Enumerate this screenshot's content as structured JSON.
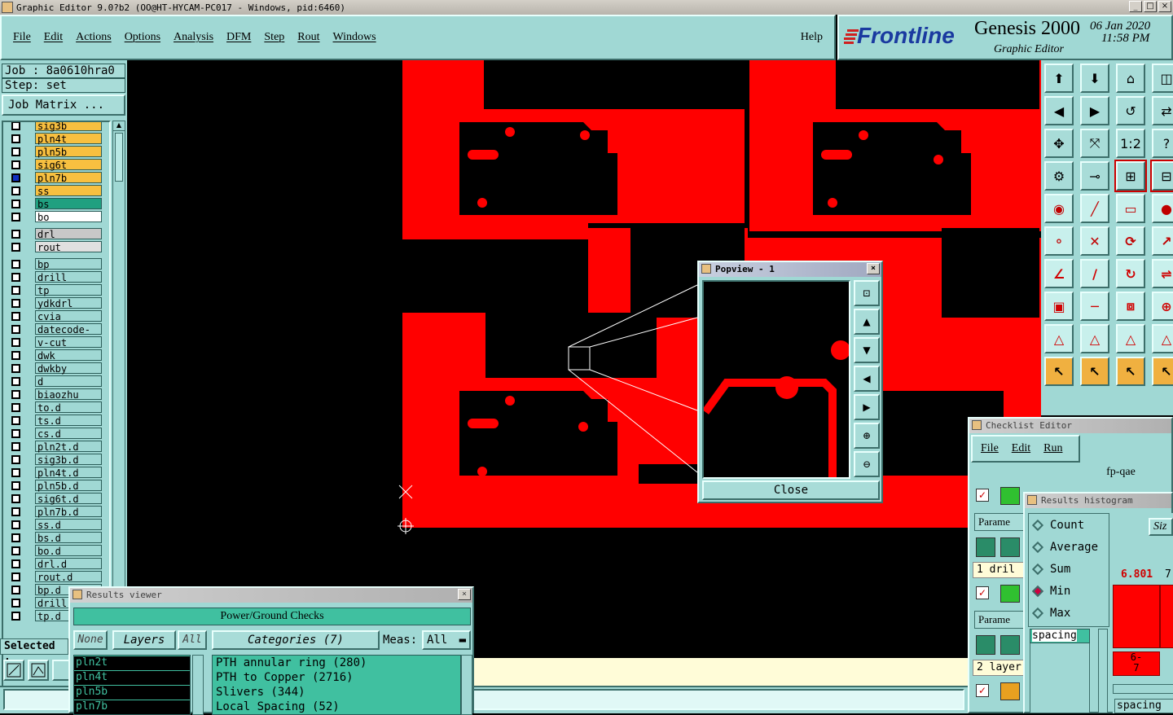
{
  "window": {
    "title": "Graphic Editor 9.0?b2 (OO@HT-HYCAM-PC017 - Windows, pid:6460)",
    "controls": [
      "_",
      "□",
      "×"
    ]
  },
  "menu": {
    "items": [
      "File",
      "Edit",
      "Actions",
      "Options",
      "Analysis",
      "DFM",
      "Step",
      "Rout",
      "Windows"
    ],
    "help": "Help"
  },
  "brand": {
    "logo": "Frontline",
    "product": "Genesis 2000",
    "subtitle": "Graphic Editor",
    "date": "06 Jan 2020",
    "time": "11:58 PM"
  },
  "job": {
    "job_label": "Job : 8a0610hra0",
    "step_label": "Step: set",
    "matrix_button": "Job Matrix ..."
  },
  "layers": [
    {
      "name": "sig3b",
      "color": "#f8c040"
    },
    {
      "name": "pln4t",
      "color": "#f8c040"
    },
    {
      "name": "pln5b",
      "color": "#f8c040"
    },
    {
      "name": "sig6t",
      "color": "#f8c040"
    },
    {
      "name": "pln7b",
      "color": "#f8c040",
      "active": true
    },
    {
      "name": "ss",
      "color": "#f8c040"
    },
    {
      "name": "bs",
      "color": "#20a080"
    },
    {
      "name": "bo",
      "color": "#ffffff"
    },
    {
      "name": "drl",
      "color": "#c8c8c8"
    },
    {
      "name": "rout",
      "color": "#e0e0e0"
    },
    {
      "name": "bp",
      "color": "#a0d8d4"
    },
    {
      "name": "drill",
      "color": "#a0d8d4"
    },
    {
      "name": "tp",
      "color": "#a0d8d4"
    },
    {
      "name": "ydkdrl",
      "color": "#a0d8d4"
    },
    {
      "name": "cvia",
      "color": "#a0d8d4"
    },
    {
      "name": "datecode-pbc",
      "color": "#a0d8d4"
    },
    {
      "name": "v-cut",
      "color": "#a0d8d4"
    },
    {
      "name": "dwk",
      "color": "#a0d8d4"
    },
    {
      "name": "dwkby",
      "color": "#a0d8d4"
    },
    {
      "name": "d",
      "color": "#a0d8d4"
    },
    {
      "name": "biaozhu",
      "color": "#a0d8d4"
    },
    {
      "name": "to.d",
      "color": "#a0d8d4"
    },
    {
      "name": "ts.d",
      "color": "#a0d8d4"
    },
    {
      "name": "cs.d",
      "color": "#a0d8d4"
    },
    {
      "name": "pln2t.d",
      "color": "#a0d8d4"
    },
    {
      "name": "sig3b.d",
      "color": "#a0d8d4"
    },
    {
      "name": "pln4t.d",
      "color": "#a0d8d4"
    },
    {
      "name": "pln5b.d",
      "color": "#a0d8d4"
    },
    {
      "name": "sig6t.d",
      "color": "#a0d8d4"
    },
    {
      "name": "pln7b.d",
      "color": "#a0d8d4"
    },
    {
      "name": "ss.d",
      "color": "#a0d8d4"
    },
    {
      "name": "bs.d",
      "color": "#a0d8d4"
    },
    {
      "name": "bo.d",
      "color": "#a0d8d4"
    },
    {
      "name": "drl.d",
      "color": "#a0d8d4"
    },
    {
      "name": "rout.d",
      "color": "#a0d8d4"
    },
    {
      "name": "bp.d",
      "color": "#a0d8d4"
    },
    {
      "name": "drill.",
      "color": "#a0d8d4"
    },
    {
      "name": "tp.d",
      "color": "#a0d8d4"
    }
  ],
  "selected_label": "Selected :",
  "popview": {
    "title": "Popview - 1",
    "close": "Close"
  },
  "results_viewer": {
    "title": "Results viewer",
    "header": "Power/Ground Checks",
    "none": "None",
    "layers": "Layers",
    "all": "All",
    "categories": "Categories (7)",
    "meas_label": "Meas:",
    "meas_value": "All",
    "layer_list": [
      "pln2t",
      "pln4t",
      "pln5b",
      "pln7b"
    ],
    "category_list": [
      "PTH annular ring (280)",
      "PTH to Copper (2716)",
      "Slivers (344)",
      "Local Spacing (52)"
    ]
  },
  "checklist": {
    "title": "Checklist Editor",
    "menu": [
      "File",
      "Edit",
      "Run"
    ],
    "name": "fp-qae",
    "param1": "Parame",
    "row1": "1 dril",
    "param2": "Parame",
    "row2": "2 layer"
  },
  "histogram": {
    "title": "Results histogram",
    "options": [
      "Count",
      "Average",
      "Sum",
      "Min",
      "Max"
    ],
    "selected": "Min",
    "field": "spacing",
    "size_label": "Siz",
    "bar_value": "6.801",
    "bar_value2": "7",
    "bar_range": "6-\n7",
    "bottom_field": "spacing"
  }
}
